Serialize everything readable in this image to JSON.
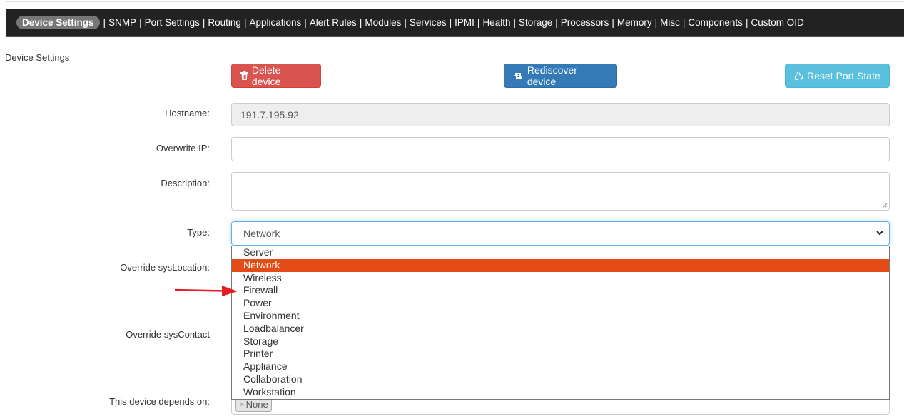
{
  "nav": {
    "active": "Device Settings",
    "items": [
      "SNMP",
      "Port Settings",
      "Routing",
      "Applications",
      "Alert Rules",
      "Modules",
      "Services",
      "IPMI",
      "Health",
      "Storage",
      "Processors",
      "Memory",
      "Misc",
      "Components",
      "Custom OID"
    ],
    "separator": "|"
  },
  "section_title": "Device Settings",
  "buttons": {
    "delete": "Delete device",
    "rediscover": "Rediscover device",
    "reset": "Reset Port State"
  },
  "form": {
    "hostname_label": "Hostname:",
    "hostname_value": "191.7.195.92",
    "overwrite_ip_label": "Overwrite IP:",
    "overwrite_ip_value": "",
    "description_label": "Description:",
    "description_value": "",
    "type_label": "Type:",
    "type_value": "Network",
    "syslocation_label": "Override sysLocation:",
    "syscontact_label": "Override sysContact",
    "depends_label": "This device depends on:",
    "depends_tag": "None",
    "depends_tag_remove": "×"
  },
  "type_options": [
    "Server",
    "Network",
    "Wireless",
    "Firewall",
    "Power",
    "Environment",
    "Loadbalancer",
    "Storage",
    "Printer",
    "Appliance",
    "Collaboration",
    "Workstation"
  ],
  "selected_option": "Network",
  "colors": {
    "navbar": "#222222",
    "danger": "#d9534f",
    "primary": "#337ab7",
    "info": "#5bc0de",
    "option_highlight": "#e34c16",
    "annotation_arrow": "#e31e24"
  },
  "icons": {
    "delete": "trash-icon",
    "rediscover": "retweet-icon",
    "reset": "recycle-icon",
    "select": "chevron-down-icon"
  }
}
